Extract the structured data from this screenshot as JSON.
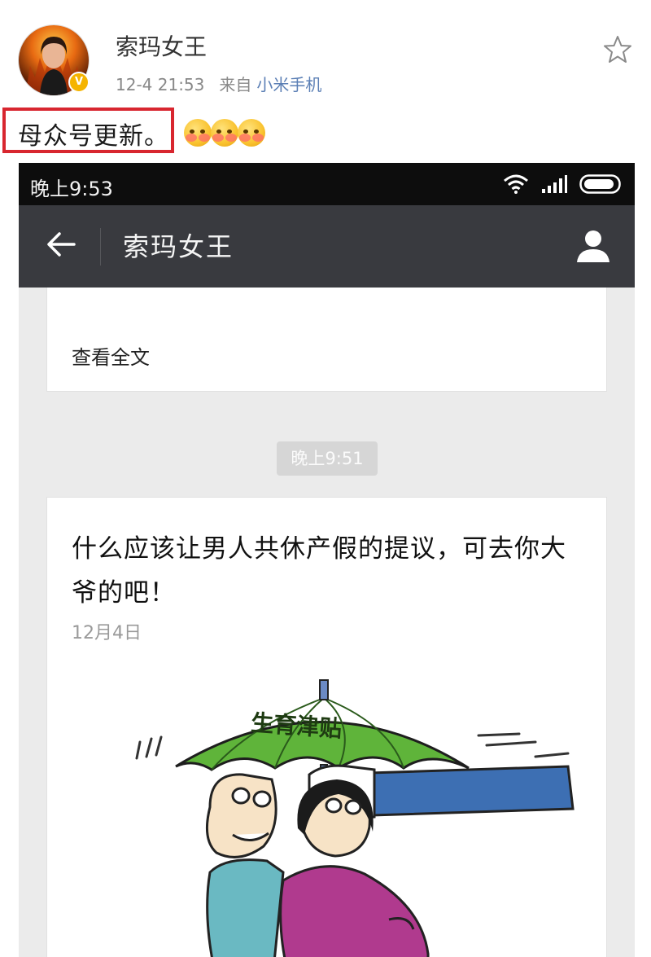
{
  "post": {
    "author": "索玛女王",
    "timestamp": "12-4 21:53",
    "source_prefix": "来自",
    "source": "小米手机",
    "text": "母众号更新。",
    "verified_badge": "V",
    "emoji_count": 3,
    "icons": {
      "favorite": "star-outline-icon",
      "verified": "verified-badge-icon"
    },
    "colors": {
      "highlight_box": "#d8262f",
      "source_link": "#5b7fb5"
    }
  },
  "phone": {
    "status_time": "晚上9:53",
    "icons": {
      "wifi": "wifi-icon",
      "signal": "signal-bars-icon",
      "battery": "battery-icon",
      "back": "back-arrow-icon",
      "profile": "profile-icon"
    },
    "nav_title": "索玛女王",
    "read_full_label": "查看全文",
    "message_time": "晚上9:51",
    "article": {
      "title": "什么应该让男人共休产假的提议，可去你大爷的吧！",
      "date": "12月4日",
      "cover_image": {
        "umbrella_text": "生育津贴",
        "colors": {
          "umbrella": "#5fb43a",
          "sleeve": "#3d6fb3",
          "woman_dress": "#b03a8e",
          "man_shirt": "#6ab9c2"
        }
      }
    },
    "colors": {
      "status_bar": "#0d0d0d",
      "nav_bar": "#393a3f",
      "background": "#ebebeb"
    }
  }
}
